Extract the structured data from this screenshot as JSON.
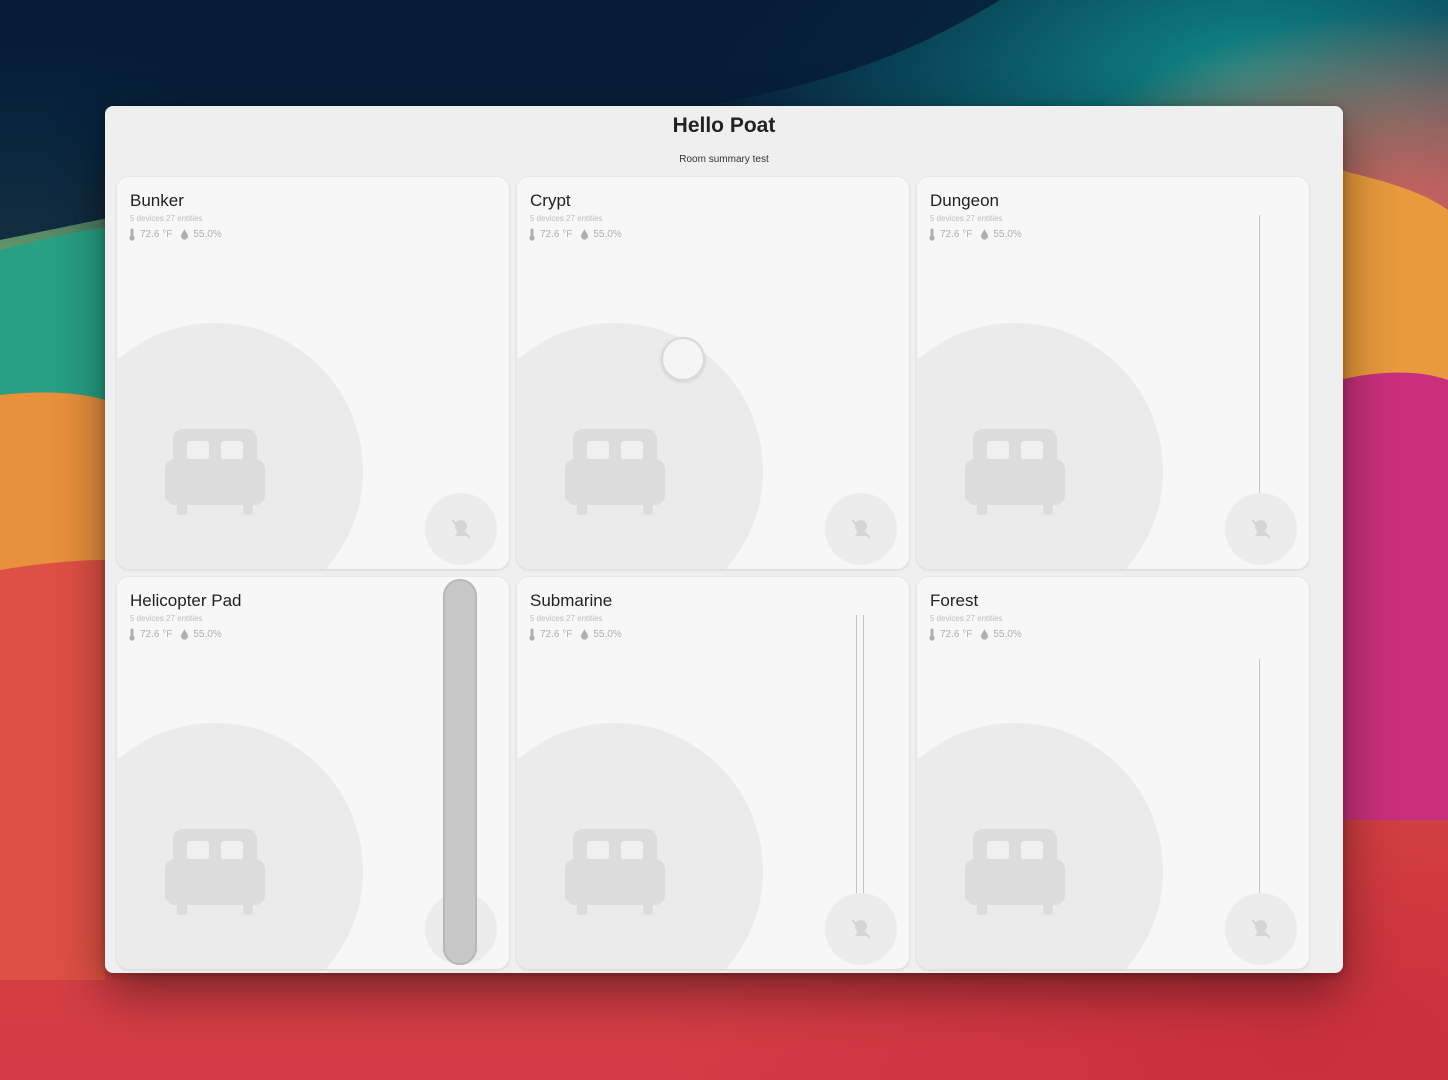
{
  "page": {
    "title": "Hello Poat",
    "subtitle": "Room summary test"
  },
  "rooms": [
    {
      "name": "Bunker",
      "counts": "5 devices 27 entities",
      "temperature": "72.6 °F",
      "humidity": "55.0%",
      "room_icon": "bed-icon",
      "action_icon": "motion-sensor-off-icon"
    },
    {
      "name": "Crypt",
      "counts": "5 devices 27 entities",
      "temperature": "72.6 °F",
      "humidity": "55.0%",
      "room_icon": "bed-icon",
      "action_icon": "motion-sensor-off-icon"
    },
    {
      "name": "Dungeon",
      "counts": "5 devices 27 entities",
      "temperature": "72.6 °F",
      "humidity": "55.0%",
      "room_icon": "bed-icon",
      "action_icon": "motion-sensor-off-icon"
    },
    {
      "name": "Helicopter Pad",
      "counts": "5 devices 27 entities",
      "temperature": "72.6 °F",
      "humidity": "55.0%",
      "room_icon": "bed-icon",
      "action_icon": "motion-sensor-off-icon"
    },
    {
      "name": "Submarine",
      "counts": "5 devices 27 entities",
      "temperature": "72.6 °F",
      "humidity": "55.0%",
      "room_icon": "bed-icon",
      "action_icon": "motion-sensor-off-icon"
    },
    {
      "name": "Forest",
      "counts": "5 devices 27 entities",
      "temperature": "72.6 °F",
      "humidity": "55.0%",
      "room_icon": "bed-icon",
      "action_icon": "motion-sensor-off-icon"
    }
  ],
  "colors": {
    "card_background": "#f7f7f7",
    "window_background": "#efefef",
    "icon_color": "#dcdcdc"
  }
}
